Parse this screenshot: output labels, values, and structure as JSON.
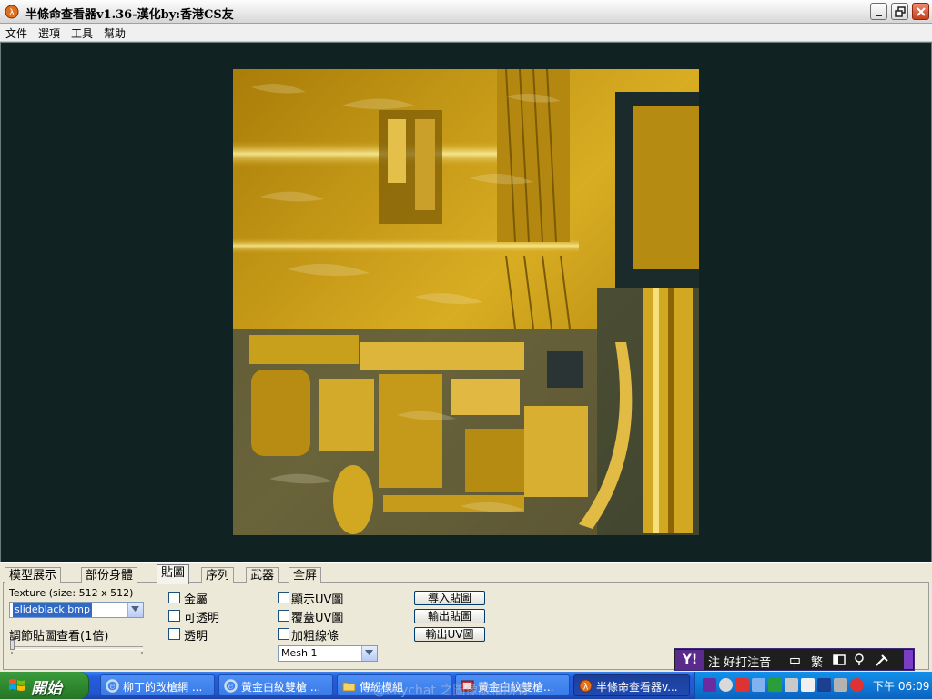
{
  "window": {
    "title": "半條命查看器v1.36-漢化by:香港CS友"
  },
  "menu": {
    "items": [
      "文件",
      "選項",
      "工具",
      "幫助"
    ]
  },
  "tabs": [
    {
      "label": "模型展示",
      "active": false
    },
    {
      "label": "部份身體",
      "active": false
    },
    {
      "label": "貼圖",
      "active": true
    },
    {
      "label": "序列",
      "active": false
    },
    {
      "label": "武器",
      "active": false
    },
    {
      "label": "全屏",
      "active": false
    }
  ],
  "texture_panel": {
    "texture_info": "Texture (size: 512 x 512)",
    "texture_file": "slideblack.bmp",
    "zoom_label": "調節貼圖查看(1倍)",
    "zoom_level": 0
  },
  "checkboxes_col1": [
    {
      "label": "金屬",
      "checked": false
    },
    {
      "label": "可透明",
      "checked": false
    },
    {
      "label": "透明",
      "checked": false
    }
  ],
  "checkboxes_col2": [
    {
      "label": "顯示UV圖",
      "checked": false
    },
    {
      "label": "覆蓋UV圖",
      "checked": false
    },
    {
      "label": "加粗線條",
      "checked": false
    }
  ],
  "mesh_select": {
    "value": "Mesh 1"
  },
  "buttons": {
    "import_texture": "導入貼圖",
    "export_texture": "輸出貼圖",
    "export_uv": "輸出UV圖"
  },
  "ime": {
    "logo": "Y!",
    "text": "注 好打注音",
    "mode": "中",
    "script": "繁"
  },
  "taskbar": {
    "start_label": "開始",
    "tasks": [
      {
        "label": "柳丁的改槍網 ..."
      },
      {
        "label": "黃金白紋雙槍 ..."
      },
      {
        "label": "傳紛模組"
      },
      {
        "label": "黃金白紋雙槍..."
      },
      {
        "label": "半條命查看器v..."
      }
    ],
    "clock": "下午 06:09",
    "watermark": "@Mlychat 之圖像版權所有"
  },
  "colors": {
    "viewport_bg": "#112222",
    "texture_gold": "#c89a10",
    "taskbar_blue": "#245ddb",
    "start_green": "#2f8a2f"
  }
}
